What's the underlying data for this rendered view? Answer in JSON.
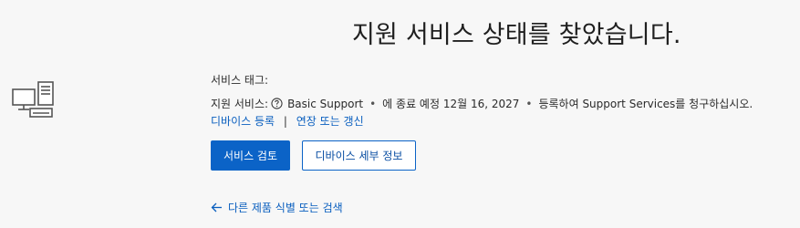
{
  "header": {
    "title": "지원 서비스 상태를 찾았습니다."
  },
  "service_info": {
    "tag_label": "서비스 태그:",
    "service_label": "지원 서비스:",
    "plan": "Basic Support",
    "expiry": "에 종료 예정 12월 16, 2027",
    "register_note": "등록하여 Support Services를 청구하십시오.",
    "register_device_link": "디바이스 등록",
    "extend_renew_link": "연장 또는 갱신"
  },
  "actions": {
    "review_service": "서비스 검토",
    "device_details": "디바이스 세부 정보"
  },
  "footer": {
    "back_link": "다른 제품 식별 또는 검색"
  },
  "icons": {
    "device": "desktop-computer-icon",
    "help": "help-circle-icon",
    "back": "arrow-left-icon"
  },
  "colors": {
    "accent": "#0b63c7",
    "link": "#0a5fbf",
    "background": "#f7f7f7"
  }
}
